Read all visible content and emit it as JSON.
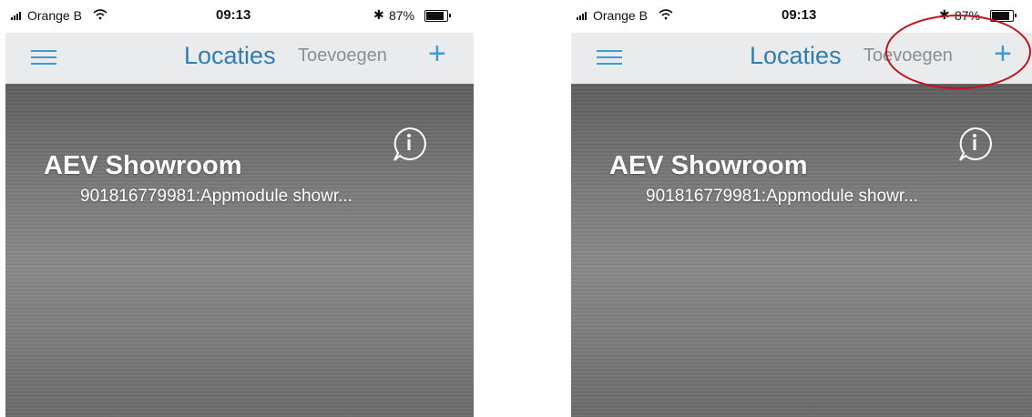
{
  "screens": [
    {
      "status_bar": {
        "carrier": "Orange B",
        "time": "09:13",
        "battery_percent": "87%",
        "bluetooth_symbol": "✱"
      },
      "nav": {
        "title": "Locaties",
        "add_label": "Toevoegen",
        "add_symbol": "+"
      },
      "location": {
        "name": "AEV Showroom",
        "subtitle": "901816779981:Appmodule showr..."
      }
    },
    {
      "status_bar": {
        "carrier": "Orange B",
        "time": "09:13",
        "battery_percent": "87%",
        "bluetooth_symbol": "✱"
      },
      "nav": {
        "title": "Locaties",
        "add_label": "Toevoegen",
        "add_symbol": "+"
      },
      "location": {
        "name": "AEV Showroom",
        "subtitle": "901816779981:Appmodule showr..."
      }
    }
  ],
  "icons": {
    "signal": "signal-bars-icon",
    "wifi": "wifi-icon",
    "bluetooth": "bluetooth-icon",
    "battery": "battery-icon",
    "menu": "hamburger-menu-icon",
    "add": "plus-icon",
    "info": "info-bubble-icon"
  },
  "colors": {
    "accent": "#3a9bd8",
    "title": "#2e7fb6",
    "nav_background": "#e9ebec",
    "add_label": "#8a8f95",
    "annotation": "#c0121b"
  },
  "battery_level": 0.87,
  "annotation": {
    "screen": 2,
    "highlights": "add-location-button"
  }
}
